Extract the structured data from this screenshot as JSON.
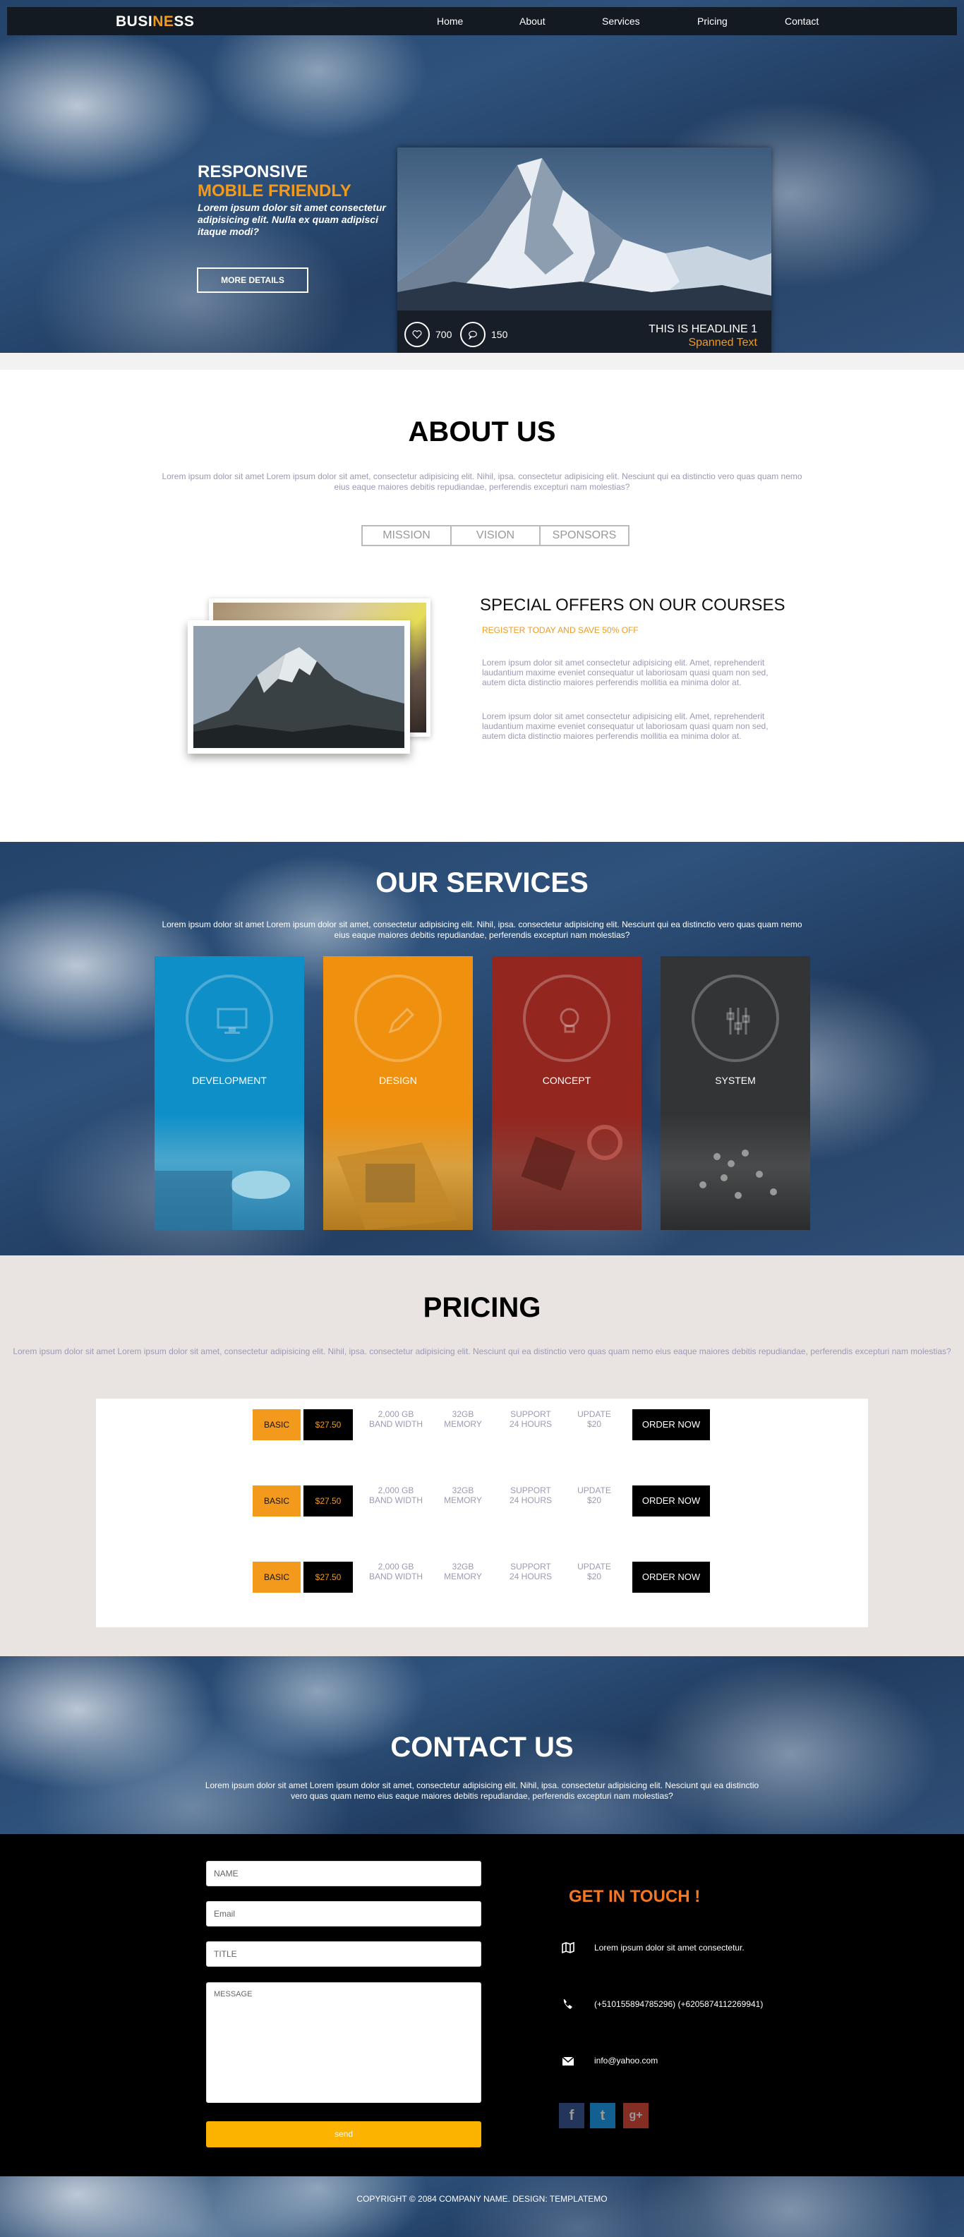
{
  "header": {
    "logo_part1": "BUSI",
    "logo_accent": "NE",
    "logo_part2": "SS",
    "nav": [
      "Home",
      "About",
      "Services",
      "Pricing",
      "Contact"
    ]
  },
  "hero": {
    "line1": "RESPONSIVE",
    "line2": "MOBILE FRIENDLY",
    "text": "Lorem ipsum dolor sit amet consectetur adipisicing elit. Nulla ex quam adipisci itaque modi?",
    "button": "MORE DETAILS",
    "likes": "700",
    "comments": "150",
    "headline": "THIS IS HEADLINE 1",
    "subtext": "Spanned Text"
  },
  "about": {
    "title": "ABOUT US",
    "desc": "Lorem ipsum dolor sit amet Lorem ipsum dolor sit amet, consectetur adipisicing elit. Nihil, ipsa. consectetur adipisicing elit. Nesciunt qui ea distinctio vero quas quam nemo eius eaque maiores debitis repudiandae, perferendis excepturi nam molestias?",
    "tabs": [
      "MISSION",
      "VISION",
      "SPONSORS"
    ],
    "offer_title": "SPECIAL OFFERS ON OUR COURSES",
    "offer_sub": "REGISTER TODAY AND SAVE 50% OFF",
    "offer_p1": "Lorem ipsum dolor sit amet consectetur adipisicing elit. Amet, reprehenderit laudantium maxime eveniet consequatur ut laboriosam quasi quam non sed, autem dicta distinctio maiores perferendis mollitia ea minima dolor at.",
    "offer_p2": "Lorem ipsum dolor sit amet consectetur adipisicing elit. Amet, reprehenderit laudantium maxime eveniet consequatur ut laboriosam quasi quam non sed, autem dicta distinctio maiores perferendis mollitia ea minima dolor at."
  },
  "services": {
    "title": "OUR SERVICES",
    "desc": "Lorem ipsum dolor sit amet Lorem ipsum dolor sit amet, consectetur adipisicing elit. Nihil, ipsa. consectetur adipisicing elit. Nesciunt qui ea distinctio vero quas quam nemo eius eaque maiores debitis repudiandae, perferendis excepturi nam molestias?",
    "items": [
      {
        "label": "DEVELOPMENT",
        "icon": "monitor-icon",
        "color": "#0f8fc7"
      },
      {
        "label": "DESIGN",
        "icon": "pencil-icon",
        "color": "#f0900f"
      },
      {
        "label": "CONCEPT",
        "icon": "lightbulb-icon",
        "color": "#93261e"
      },
      {
        "label": "SYSTEM",
        "icon": "sliders-icon",
        "color": "#333435"
      }
    ]
  },
  "pricing": {
    "title": "PRICING",
    "desc": "Lorem ipsum dolor sit amet Lorem ipsum dolor sit amet, consectetur adipisicing elit. Nihil, ipsa. consectetur adipisicing elit. Nesciunt qui ea distinctio vero quas quam nemo eius eaque maiores debitis repudiandae, perferendis excepturi nam molestias?",
    "plans": [
      {
        "name": "BASIC",
        "price": "$27.50",
        "bw1": "2,000 GB",
        "bw2": "BAND WIDTH",
        "mem1": "32GB",
        "mem2": "MEMORY",
        "sup1": "SUPPORT",
        "sup2": "24 HOURS",
        "up1": "UPDATE",
        "up2": "$20",
        "order": "ORDER NOW"
      },
      {
        "name": "BASIC",
        "price": "$27.50",
        "bw1": "2,000 GB",
        "bw2": "BAND WIDTH",
        "mem1": "32GB",
        "mem2": "MEMORY",
        "sup1": "SUPPORT",
        "sup2": "24 HOURS",
        "up1": "UPDATE",
        "up2": "$20",
        "order": "ORDER NOW"
      },
      {
        "name": "BASIC",
        "price": "$27.50",
        "bw1": "2,000 GB",
        "bw2": "BAND WIDTH",
        "mem1": "32GB",
        "mem2": "MEMORY",
        "sup1": "SUPPORT",
        "sup2": "24 HOURS",
        "up1": "UPDATE",
        "up2": "$20",
        "order": "ORDER NOW"
      }
    ]
  },
  "contact": {
    "title": "CONTACT US",
    "desc": "Lorem ipsum dolor sit amet Lorem ipsum dolor sit amet, consectetur adipisicing elit. Nihil, ipsa. consectetur adipisicing elit. Nesciunt qui ea distinctio vero quas quam nemo eius eaque maiores debitis repudiandae, perferendis excepturi nam molestias?",
    "form": {
      "name_placeholder": "NAME",
      "email_placeholder": "Email",
      "title_placeholder": "TITLE",
      "message_placeholder": "MESSAGE",
      "send": "send"
    },
    "get_in_touch": "GET IN TOUCH !",
    "address": "Lorem ipsum dolor sit amet consectetur.",
    "phone": "(+510155894785296) (+6205874112269941)",
    "email": "info@yahoo.com",
    "social": [
      {
        "icon": "facebook-icon",
        "glyph": "f",
        "color": "#3b5998"
      },
      {
        "icon": "twitter-icon",
        "glyph": "t",
        "color": "#1da1f2"
      },
      {
        "icon": "google-plus-icon",
        "glyph": "g+",
        "color": "#dd4b39"
      }
    ]
  },
  "footer": {
    "copyright": "COPYRIGHT © 2084 COMPANY NAME. DESIGN: TEMPLATEMO"
  },
  "colors": {
    "accent": "#f39a1c",
    "nav_bg": "#141a22",
    "pricing_bg": "#e9e4e2",
    "send_button": "#fbb300"
  }
}
